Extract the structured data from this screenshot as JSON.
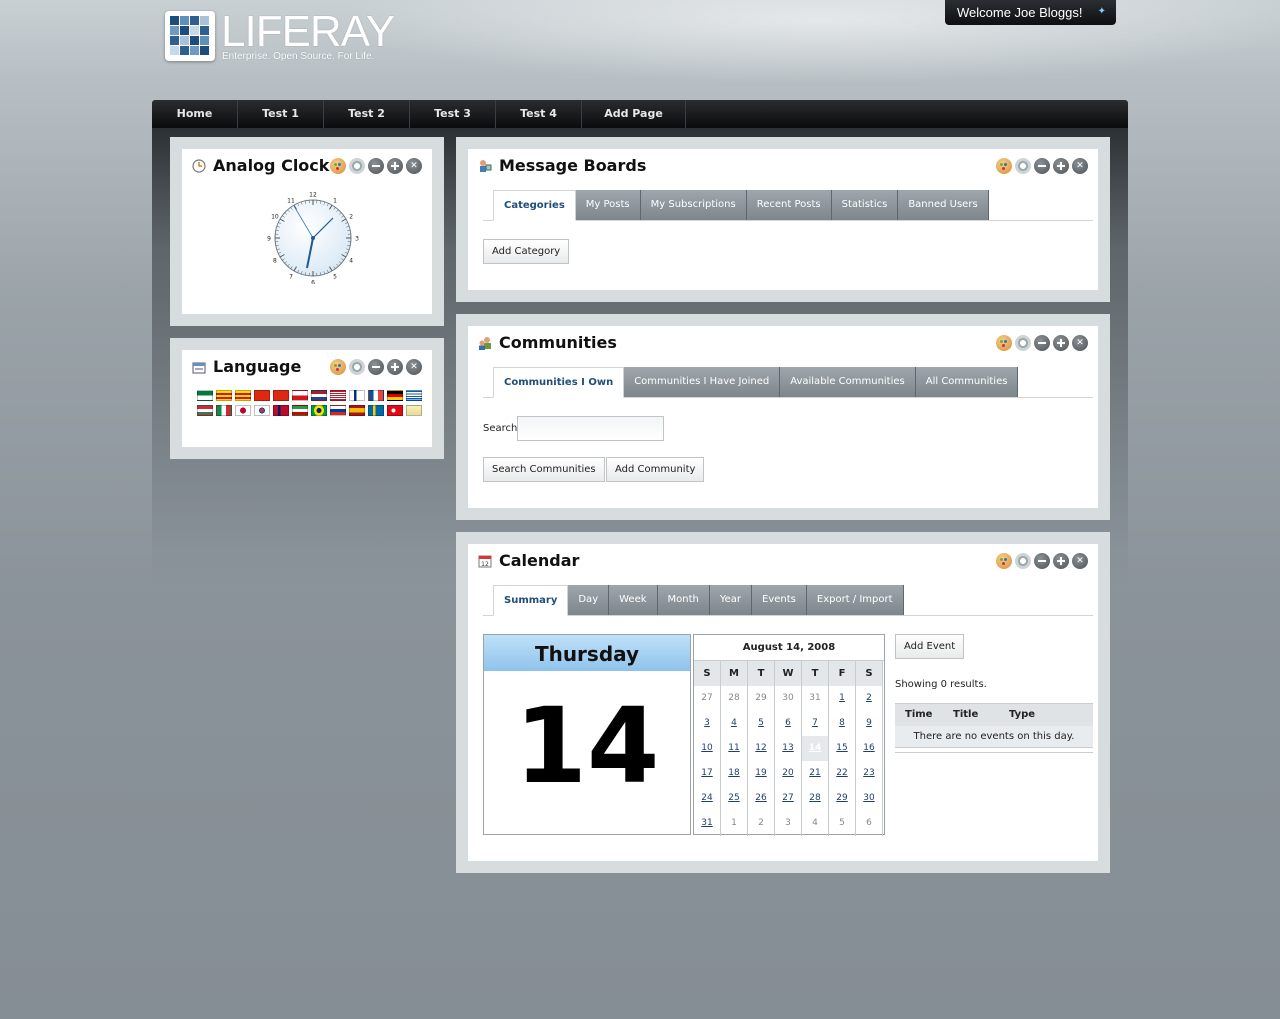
{
  "header": {
    "logo_text": "LIFERAY",
    "tagline": "Enterprise. Open Source. For Life.",
    "welcome": "Welcome Joe Bloggs!"
  },
  "nav": [
    "Home",
    "Test 1",
    "Test 2",
    "Test 3",
    "Test 4",
    "Add Page"
  ],
  "analog_clock": {
    "title": "Analog Clock",
    "numbers": [
      "12",
      "1",
      "2",
      "3",
      "4",
      "5",
      "6",
      "7",
      "8",
      "9",
      "10",
      "11"
    ]
  },
  "language": {
    "title": "Language",
    "flags": [
      "arabic",
      "catalan",
      "catalan",
      "chinese",
      "chinese",
      "czech",
      "dutch",
      "english",
      "finnish",
      "french",
      "german",
      "greek",
      "hungarian",
      "italian",
      "japanese",
      "korean",
      "norwegian",
      "persian",
      "portuguese",
      "russian",
      "spanish",
      "swedish",
      "turkish",
      "vietnamese"
    ]
  },
  "message_boards": {
    "title": "Message Boards",
    "tabs": [
      "Categories",
      "My Posts",
      "My Subscriptions",
      "Recent Posts",
      "Statistics",
      "Banned Users"
    ],
    "add_button": "Add Category"
  },
  "communities": {
    "title": "Communities",
    "tabs": [
      "Communities I Own",
      "Communities I Have Joined",
      "Available Communities",
      "All Communities"
    ],
    "search_label": "Search",
    "search_value": "",
    "search_button": "Search Communities",
    "add_button": "Add Community"
  },
  "calendar": {
    "title": "Calendar",
    "tabs": [
      "Summary",
      "Day",
      "Week",
      "Month",
      "Year",
      "Events",
      "Export / Import"
    ],
    "weekday": "Thursday",
    "day_number": "14",
    "month_title": "August 14, 2008",
    "weekday_headers": [
      "S",
      "M",
      "T",
      "W",
      "T",
      "F",
      "S"
    ],
    "days": [
      [
        "27",
        "28",
        "29",
        "30",
        "31",
        "1",
        "2"
      ],
      [
        "3",
        "4",
        "5",
        "6",
        "7",
        "8",
        "9"
      ],
      [
        "10",
        "11",
        "12",
        "13",
        "14",
        "15",
        "16"
      ],
      [
        "17",
        "18",
        "19",
        "20",
        "21",
        "22",
        "23"
      ],
      [
        "24",
        "25",
        "26",
        "27",
        "28",
        "29",
        "30"
      ],
      [
        "31",
        "1",
        "2",
        "3",
        "4",
        "5",
        "6"
      ]
    ],
    "add_event": "Add Event",
    "results": "Showing 0 results.",
    "table_headers": [
      "Time",
      "Title",
      "Type"
    ],
    "empty_message": "There are no events on this day."
  },
  "colors": {
    "accent_blue": "#1f4e79",
    "tab_gray": "#8a9399",
    "portlet_frame": "#d7dcdf"
  }
}
